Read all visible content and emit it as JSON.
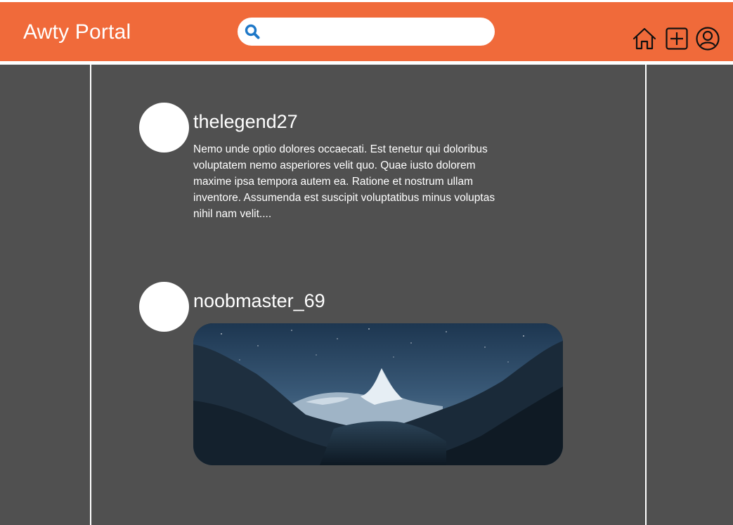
{
  "header": {
    "brand": "Awty Portal",
    "accent_color": "#F06A3A"
  },
  "search": {
    "value": "",
    "placeholder": "",
    "icon": "search-icon"
  },
  "nav_icons": [
    "home-icon",
    "add-icon",
    "account-icon"
  ],
  "feed": {
    "posts": [
      {
        "username": "thelegend27",
        "text": "Nemo unde optio dolores occaecati. Est tenetur qui doloribus voluptatem nemo asperiores velit quo. Quae iusto dolorem maxime ipsa tempora autem ea. Ratione et nostrum ullam inventore. Assumenda est suscipit voluptatibus minus voluptas nihil nam velit...."
      },
      {
        "username": "noobmaster_69",
        "image": "mountain-night-photo"
      }
    ]
  }
}
